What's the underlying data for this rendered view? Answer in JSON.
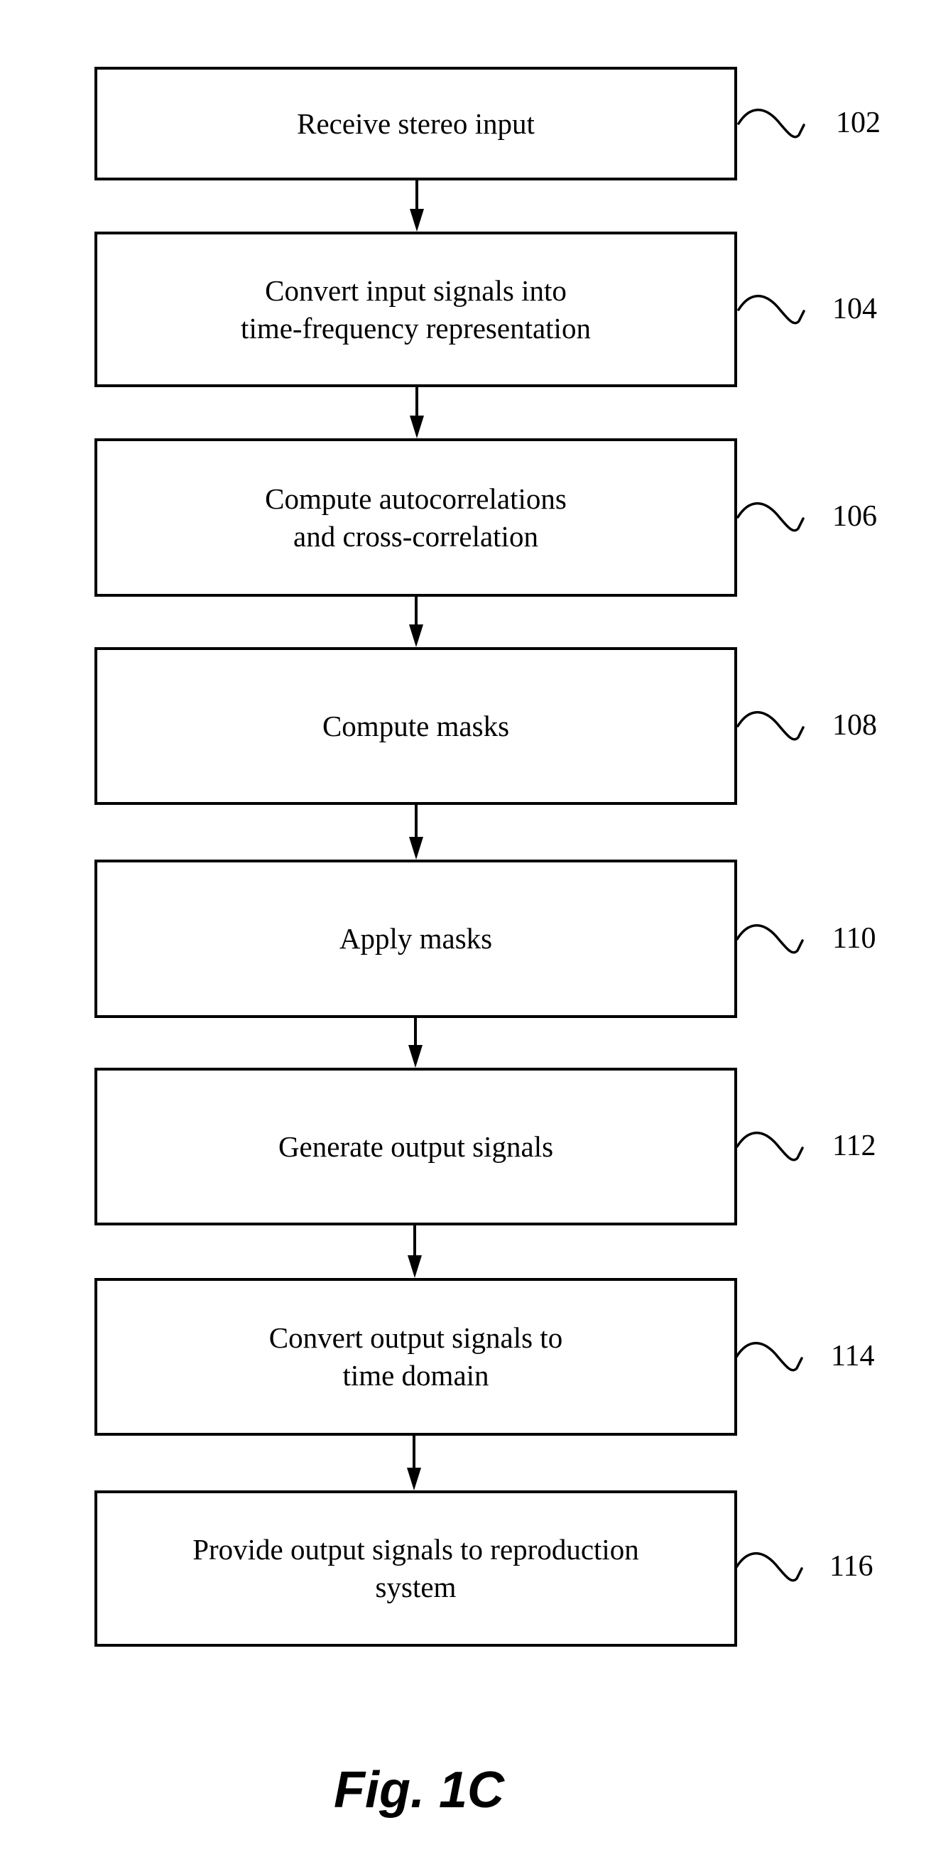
{
  "figure": {
    "caption": "Fig. 1C",
    "steps": [
      {
        "id": "102",
        "text": "Receive stereo input"
      },
      {
        "id": "104",
        "text": "Convert input signals into\ntime-frequency representation"
      },
      {
        "id": "106",
        "text": "Compute autocorrelations\nand cross-correlation"
      },
      {
        "id": "108",
        "text": "Compute masks"
      },
      {
        "id": "110",
        "text": "Apply masks"
      },
      {
        "id": "112",
        "text": "Generate output signals"
      },
      {
        "id": "114",
        "text": "Convert output signals to\ntime domain"
      },
      {
        "id": "116",
        "text": "Provide output signals to reproduction\nsystem"
      }
    ]
  }
}
